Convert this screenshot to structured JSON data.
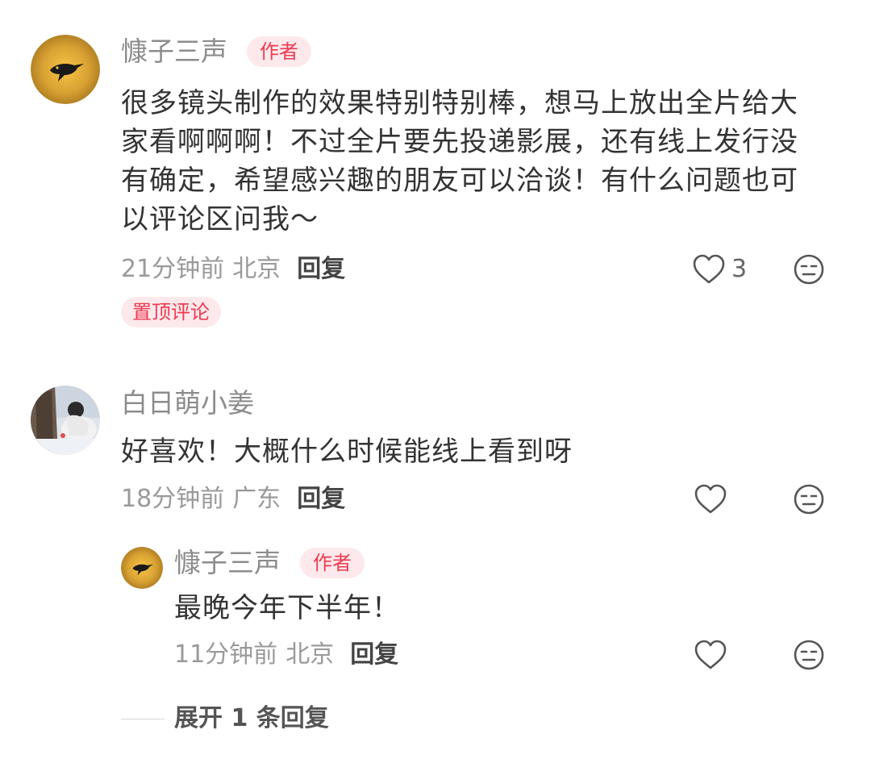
{
  "comments": [
    {
      "username": "慷子三声",
      "badge": "作者",
      "avatar_icon": "bird-sun-avatar",
      "text_lines": [
        "很多镜头制作的效果特别特别棒，想马上放出全片给大",
        "家看啊啊啊！不过全片要先投递影展，还有线上发行没",
        "有确定，希望感兴趣的朋友可以洽谈！有什么问题也可",
        "以评论区问我～"
      ],
      "time": "21分钟前",
      "location": "北京",
      "reply_label": "回复",
      "like_count": "3",
      "pinned_label": "置顶评论"
    },
    {
      "username": "白日萌小姜",
      "avatar_icon": "snow-photo-avatar",
      "text": "好喜欢！大概什么时候能线上看到呀",
      "time": "18分钟前",
      "location": "广东",
      "reply_label": "回复"
    }
  ],
  "reply": {
    "username": "慷子三声",
    "badge": "作者",
    "avatar_icon": "bird-sun-avatar",
    "text": "最晚今年下半年！",
    "time": "11分钟前",
    "location": "北京",
    "reply_label": "回复"
  },
  "expand_label": "展开 1 条回复",
  "colors": {
    "badge_bg": "#fde9ec",
    "badge_text": "#ee3a50",
    "avatar_gold": "#c9962e"
  },
  "icons": [
    "heart-icon",
    "dislike-face-icon"
  ]
}
